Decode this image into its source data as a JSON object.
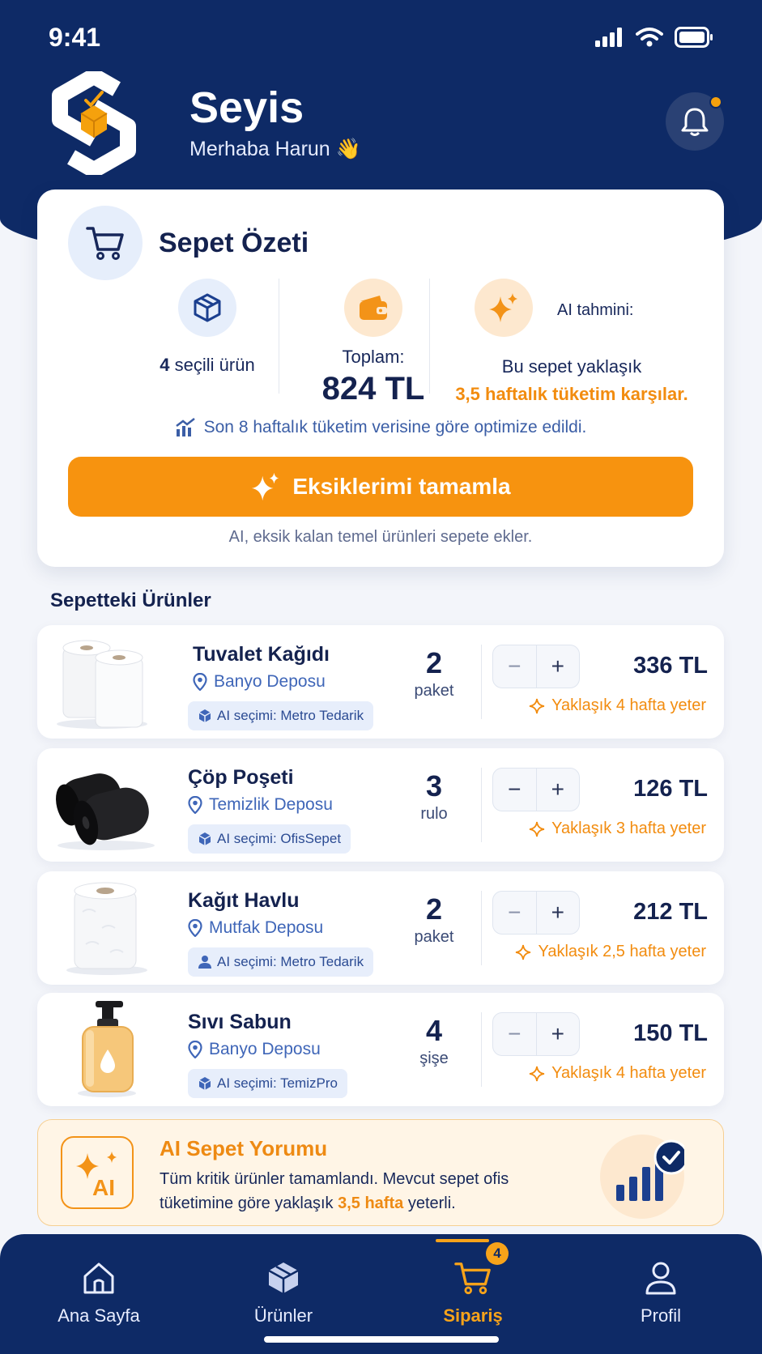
{
  "status_bar": {
    "time": "9:41"
  },
  "header": {
    "app_name": "Seyis",
    "greeting": "Merhaba Harun 👋"
  },
  "summary": {
    "title": "Sepet Özeti",
    "selected_count": "4",
    "selected_label": "seçili ürün",
    "total_label": "Toplam:",
    "total_value": "824 TL",
    "ai_label": "AI tahmini:",
    "ai_line1": "Bu sepet yaklaşık",
    "ai_line2": "3,5 haftalık tüketim karşılar.",
    "optimized_note": "Son 8 haftalık tüketim verisine göre optimize edildi.",
    "complete_button": "Eksiklerimi tamamla",
    "complete_note": "AI, eksik kalan temel ürünleri sepete ekler."
  },
  "section_title": "Sepetteki Ürünler",
  "items": [
    {
      "name": "Tuvalet Kağıdı",
      "location": "Banyo Deposu",
      "ai_choice": "AI seçimi: Metro Tedarik",
      "qty": "2",
      "unit": "paket",
      "price": "336 TL",
      "eta": "Yaklaşık 4 hafta yeter"
    },
    {
      "name": "Çöp Poşeti",
      "location": "Temizlik Deposu",
      "ai_choice": "AI seçimi: OfisSepet",
      "qty": "3",
      "unit": "rulo",
      "price": "126 TL",
      "eta": "Yaklaşık 3 hafta yeter"
    },
    {
      "name": "Kağıt Havlu",
      "location": "Mutfak Deposu",
      "ai_choice": "AI seçimi: Metro Tedarik",
      "qty": "2",
      "unit": "paket",
      "price": "212 TL",
      "eta": "Yaklaşık 2,5 hafta yeter"
    },
    {
      "name": "Sıvı Sabun",
      "location": "Banyo Deposu",
      "ai_choice": "AI seçimi: TemizPro",
      "qty": "4",
      "unit": "şişe",
      "price": "150 TL",
      "eta": "Yaklaşık 4 hafta yeter"
    }
  ],
  "stepper": {
    "minus": "−",
    "plus": "+"
  },
  "ai_comment": {
    "title": "AI Sepet Yorumu",
    "text_part1": "Tüm kritik ürünler tamamlandı. Mevcut sepet ofis tüketimine göre yaklaşık ",
    "text_highlight": "3,5 hafta",
    "text_part2": " yeterli."
  },
  "tabs": [
    {
      "label": "Ana Sayfa",
      "icon": "home-icon"
    },
    {
      "label": "Ürünler",
      "icon": "box-icon"
    },
    {
      "label": "Sipariş",
      "icon": "cart-icon",
      "badge": "4",
      "active": true
    },
    {
      "label": "Profil",
      "icon": "user-icon"
    }
  ],
  "colors": {
    "primary": "#0e2a66",
    "accent": "#f7930f",
    "highlight": "#ee8a13"
  }
}
